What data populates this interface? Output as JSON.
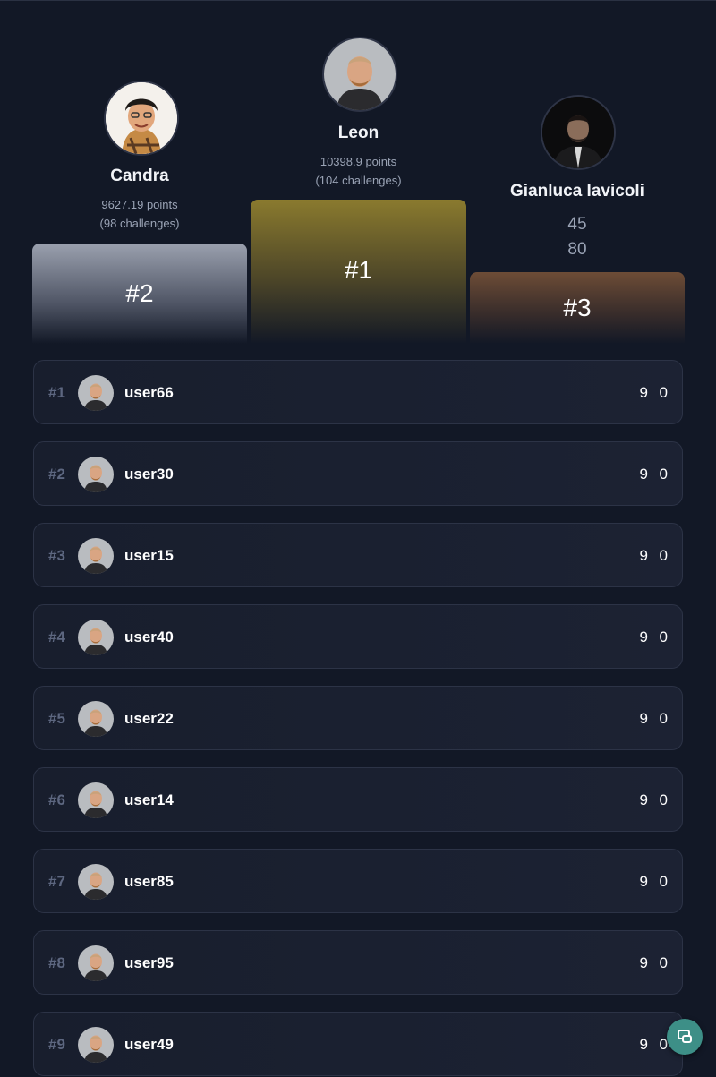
{
  "podium": {
    "first": {
      "rank_label": "#1",
      "name": "Leon",
      "points": "10398.9 points",
      "challenges": "(104 challenges)"
    },
    "second": {
      "rank_label": "#2",
      "name": "Candra",
      "points": "9627.19 points",
      "challenges": "(98 challenges)"
    },
    "third": {
      "rank_label": "#3",
      "name": "Gianluca Iavicoli",
      "line1": "45",
      "line2": "80"
    },
    "colors": {
      "gold": "#8a7a2e",
      "silver": "#9aa0ae",
      "bronze": "#6d4c36"
    }
  },
  "rows": [
    {
      "rank": "#1",
      "username": "user66",
      "value_a": "9",
      "value_b": "0"
    },
    {
      "rank": "#2",
      "username": "user30",
      "value_a": "9",
      "value_b": "0"
    },
    {
      "rank": "#3",
      "username": "user15",
      "value_a": "9",
      "value_b": "0"
    },
    {
      "rank": "#4",
      "username": "user40",
      "value_a": "9",
      "value_b": "0"
    },
    {
      "rank": "#5",
      "username": "user22",
      "value_a": "9",
      "value_b": "0"
    },
    {
      "rank": "#6",
      "username": "user14",
      "value_a": "9",
      "value_b": "0"
    },
    {
      "rank": "#7",
      "username": "user85",
      "value_a": "9",
      "value_b": "0"
    },
    {
      "rank": "#8",
      "username": "user95",
      "value_a": "9",
      "value_b": "0"
    },
    {
      "rank": "#9",
      "username": "user49",
      "value_a": "9",
      "value_b": "0"
    }
  ],
  "fab": {
    "icon": "layout-toggle-icon",
    "color": "#3d8f87"
  }
}
